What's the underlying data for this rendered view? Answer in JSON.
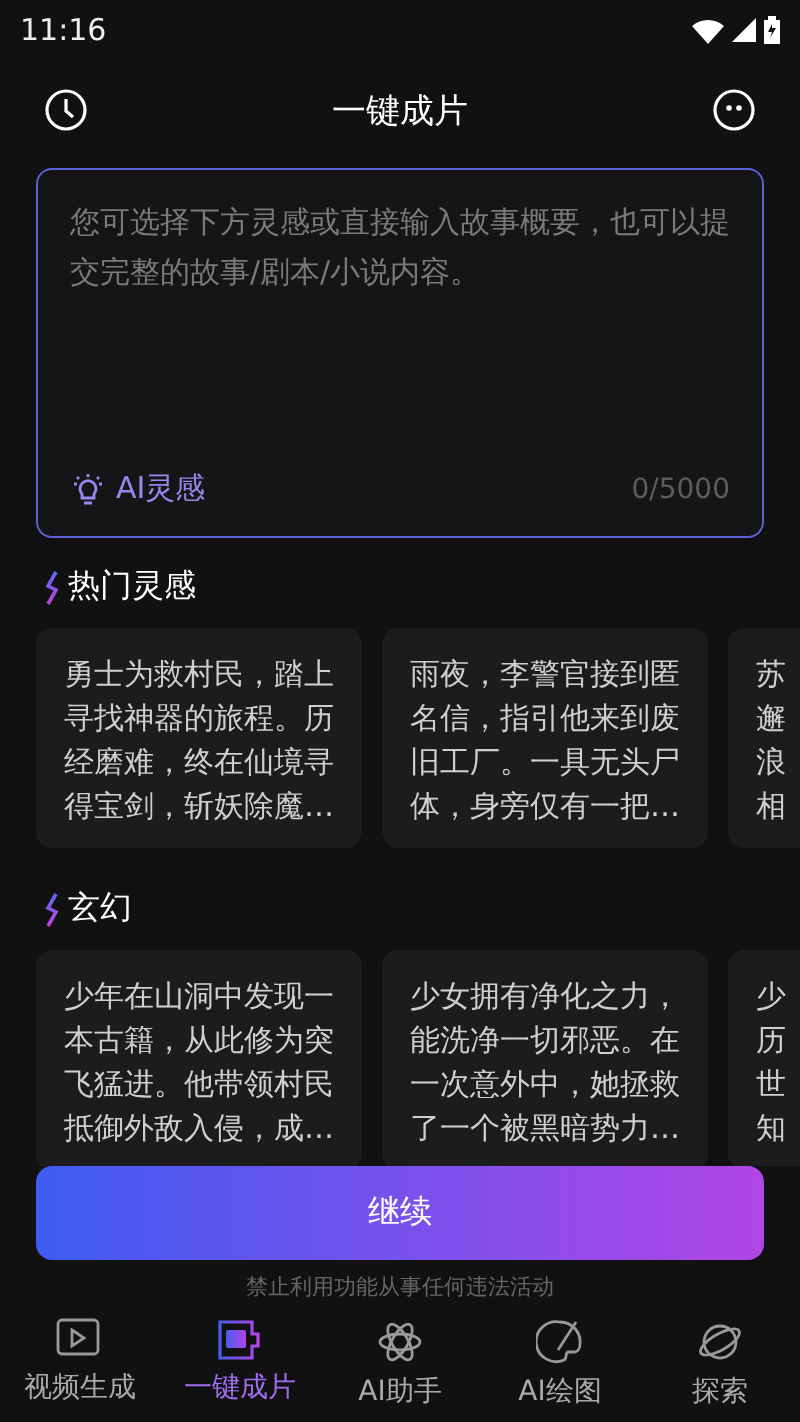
{
  "status_bar": {
    "time": "11:16"
  },
  "header": {
    "title": "一键成片"
  },
  "editor": {
    "placeholder": "您可选择下方灵感或直接输入故事概要，也可以提交完整的故事/剧本/小说内容。",
    "inspire_button": "AI灵感",
    "counter": "0/5000"
  },
  "sections": [
    {
      "title": "热门灵感",
      "cards": [
        {
          "text": "勇士为救村民，踏上寻找神器的旅程。历经磨难，终在仙境寻得宝剑，斩妖除魔…",
          "cut": false
        },
        {
          "text": "雨夜，李警官接到匿名信，指引他来到废旧工厂。一具无头尸体，身旁仅有一把…",
          "cut": false
        },
        {
          "text": "苏邂浪相",
          "cut": true
        }
      ]
    },
    {
      "title": "玄幻",
      "cards": [
        {
          "text": "少年在山洞中发现一本古籍，从此修为突飞猛进。他带领村民抵御外敌入侵，成…",
          "cut": false
        },
        {
          "text": "少女拥有净化之力，能洗净一切邪恶。在一次意外中，她拯救了一个被黑暗势力…",
          "cut": false
        },
        {
          "text": "少历世知",
          "cut": true
        }
      ]
    }
  ],
  "continue_button": "继续",
  "notice": "禁止利用功能从事任何违法活动",
  "tabs": [
    {
      "label": "视频生成",
      "selected": false
    },
    {
      "label": "一键成片",
      "selected": true
    },
    {
      "label": "AI助手",
      "selected": false
    },
    {
      "label": "AI绘图",
      "selected": false
    },
    {
      "label": "探索",
      "selected": false
    }
  ]
}
